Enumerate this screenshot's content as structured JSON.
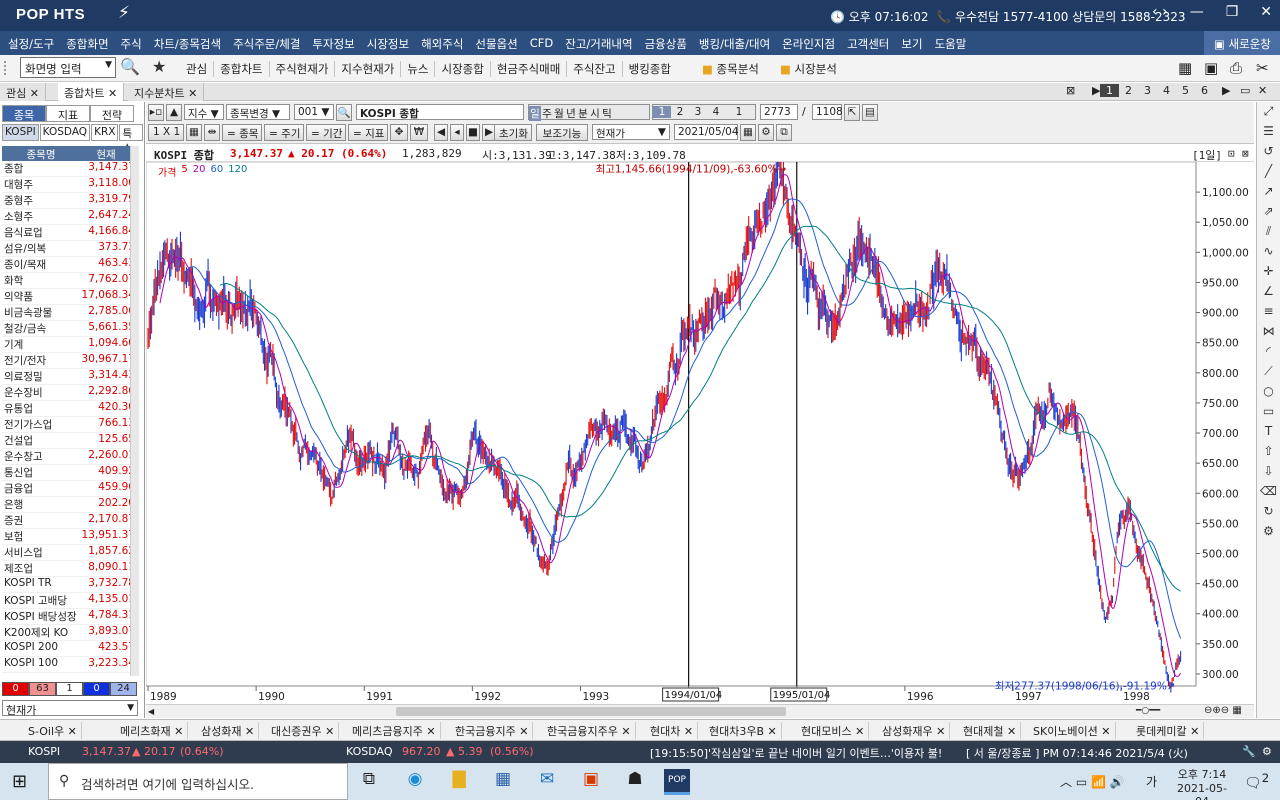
{
  "titlebar": {
    "logo": "POP HTS",
    "clock": "오후 07:16:02",
    "info": "우수전담 1577-4100 상담문의 1588-2323"
  },
  "menu": {
    "items": [
      "설정/도구",
      "종합화면",
      "주식",
      "차트/종목검색",
      "주식주문/체결",
      "투자정보",
      "시장정보",
      "해외주식",
      "선물옵션",
      "CFD",
      "잔고/거래내역",
      "금융상품",
      "뱅킹/대출/대여",
      "온라인지점",
      "고객센터",
      "보기",
      "도움말"
    ],
    "new_window": "새로운창"
  },
  "toolbar": {
    "screen_input": "화면명 입력",
    "links": [
      "관심",
      "종합차트",
      "주식현재가",
      "지수현재가",
      "뉴스",
      "시장종합",
      "현금주식매매",
      "주식잔고",
      "뱅킹종합"
    ],
    "folders": [
      "종목분석",
      "시장분석"
    ]
  },
  "window_tabs": [
    {
      "label": "관심",
      "active": false
    },
    {
      "label": "종합차트",
      "active": true
    },
    {
      "label": "지수분차트",
      "active": false
    }
  ],
  "page_numbers": [
    "1",
    "2",
    "3",
    "4",
    "5",
    "6"
  ],
  "left_panel": {
    "tabs": [
      "종목",
      "지표",
      "전략"
    ],
    "subtabs": [
      "KOSPI",
      "KOSDAQ",
      "KRX",
      "특수"
    ],
    "header": {
      "name": "종목명",
      "price": "현재"
    },
    "rows": [
      [
        "종합",
        "3,147.37"
      ],
      [
        "대형주",
        "3,118.00"
      ],
      [
        "중형주",
        "3,319.79"
      ],
      [
        "소형주",
        "2,647.24"
      ],
      [
        "음식료업",
        "4,166.84"
      ],
      [
        "섬유/의복",
        "373.73"
      ],
      [
        "종이/목재",
        "463.43"
      ],
      [
        "화학",
        "7,762.07"
      ],
      [
        "의약품",
        "17,068.34"
      ],
      [
        "비금속광물",
        "2,785.06"
      ],
      [
        "철강/금속",
        "5,661.35"
      ],
      [
        "기계",
        "1,094.60"
      ],
      [
        "전기/전자",
        "30,967.17"
      ],
      [
        "의료정밀",
        "3,314.43"
      ],
      [
        "운수장비",
        "2,292.86"
      ],
      [
        "유통업",
        "420.30"
      ],
      [
        "전기가스업",
        "766.13"
      ],
      [
        "건설업",
        "125.65"
      ],
      [
        "운수창고",
        "2,260.01"
      ],
      [
        "통신업",
        "409.92"
      ],
      [
        "금융업",
        "459.96"
      ],
      [
        "은행",
        "202.20"
      ],
      [
        "증권",
        "2,170.87"
      ],
      [
        "보험",
        "13,951.37"
      ],
      [
        "서비스업",
        "1,857.62"
      ],
      [
        "제조업",
        "8,090.11"
      ],
      [
        "KOSPI TR",
        "3,732.78"
      ],
      [
        "KOSPI 고배당",
        "4,135.01"
      ],
      [
        "KOSPI 배당성장",
        "4,784.31"
      ],
      [
        "K200제외 KO",
        "3,893.07"
      ],
      [
        "KOSPI 200",
        "423.57"
      ],
      [
        "KOSPI 100",
        "3,223.34"
      ]
    ],
    "counts": [
      "0",
      "63",
      "1",
      "0",
      "24"
    ],
    "select": "현재가"
  },
  "chart_toolbar": {
    "type": "지수",
    "change": "종목변경",
    "code": "001",
    "name": "KOSPI 종합",
    "periods": [
      "일",
      "주",
      "월",
      "년",
      "분",
      "시",
      "틱"
    ],
    "nums": [
      "1",
      "2",
      "3",
      "4",
      "1"
    ],
    "count": "2773",
    "total": "1108",
    "ratio": "1 X 1",
    "btn_stock": "= 종목",
    "btn_period": "= 주기",
    "btn_range": "= 기간",
    "btn_indicator": "= 지표",
    "reset": "초기화",
    "aux": "보조기능",
    "price_type": "현재가",
    "date": "2021/05/04"
  },
  "infobar": {
    "name": "KOSPI 종합",
    "price": "3,147.37",
    "change": "▲ 20.17 (0.64%)",
    "volume": "1,283,829",
    "open": "시:3,131.39",
    "high": "고:3,147.38",
    "low": "저:3,109.78",
    "period": "[1일]"
  },
  "legend": [
    {
      "label": "가격",
      "color": "#d40000"
    },
    {
      "label": "5",
      "color": "#d40000"
    },
    {
      "label": "20",
      "color": "#b000b0"
    },
    {
      "label": "60",
      "color": "#2060d0"
    },
    {
      "label": "120",
      "color": "#008080"
    }
  ],
  "chart_data": {
    "type": "line",
    "title": "",
    "x_years": [
      "1989",
      "1990",
      "1991",
      "1992",
      "1993",
      "1994",
      "1995",
      "1996",
      "1997",
      "1998"
    ],
    "markers": [
      "1994/01/04",
      "1995/01/04"
    ],
    "y_ticks": [
      300,
      350,
      400,
      450,
      500,
      550,
      600,
      650,
      700,
      750,
      800,
      850,
      900,
      950,
      1000,
      1050,
      1100
    ],
    "ylim": [
      280,
      1150
    ],
    "annotation_high": "최고1,145.66(1994/11/09),-63.60%",
    "annotation_low": "최저277.37(1998/06/16),-91.19%",
    "series": [
      {
        "values_by_time": [
          [
            1989.0,
            870
          ],
          [
            1989.1,
            950
          ],
          [
            1989.3,
            1000
          ],
          [
            1989.45,
            900
          ],
          [
            1989.55,
            930
          ],
          [
            1989.7,
            920
          ],
          [
            1989.85,
            890
          ],
          [
            1990.0,
            880
          ],
          [
            1990.15,
            800
          ],
          [
            1990.3,
            740
          ],
          [
            1990.5,
            650
          ],
          [
            1990.7,
            580
          ],
          [
            1990.85,
            700
          ],
          [
            1990.95,
            650
          ],
          [
            1991.1,
            640
          ],
          [
            1991.3,
            690
          ],
          [
            1991.5,
            630
          ],
          [
            1991.6,
            680
          ],
          [
            1991.75,
            590
          ],
          [
            1991.9,
            620
          ],
          [
            1992.0,
            690
          ],
          [
            1992.15,
            640
          ],
          [
            1992.3,
            610
          ],
          [
            1992.5,
            560
          ],
          [
            1992.65,
            480
          ],
          [
            1992.7,
            470
          ],
          [
            1992.8,
            580
          ],
          [
            1992.9,
            650
          ],
          [
            1993.0,
            660
          ],
          [
            1993.2,
            700
          ],
          [
            1993.4,
            730
          ],
          [
            1993.6,
            660
          ],
          [
            1993.75,
            760
          ],
          [
            1993.9,
            840
          ],
          [
            1994.0,
            870
          ],
          [
            1994.15,
            900
          ],
          [
            1994.3,
            920
          ],
          [
            1994.5,
            960
          ],
          [
            1994.7,
            1080
          ],
          [
            1994.86,
            1145.66
          ],
          [
            1994.95,
            1000
          ],
          [
            1995.05,
            1000
          ],
          [
            1995.2,
            900
          ],
          [
            1995.35,
            880
          ],
          [
            1995.5,
            990
          ],
          [
            1995.6,
            1000
          ],
          [
            1995.75,
            930
          ],
          [
            1995.9,
            880
          ],
          [
            1996.0,
            870
          ],
          [
            1996.15,
            900
          ],
          [
            1996.3,
            970
          ],
          [
            1996.4,
            950
          ],
          [
            1996.55,
            860
          ],
          [
            1996.7,
            800
          ],
          [
            1996.85,
            760
          ],
          [
            1996.95,
            680
          ],
          [
            1997.05,
            640
          ],
          [
            1997.2,
            700
          ],
          [
            1997.35,
            770
          ],
          [
            1997.45,
            730
          ],
          [
            1997.55,
            720
          ],
          [
            1997.65,
            640
          ],
          [
            1997.8,
            450
          ],
          [
            1997.85,
            380
          ],
          [
            1997.92,
            420
          ],
          [
            1997.98,
            550
          ],
          [
            1998.08,
            560
          ],
          [
            1998.2,
            470
          ],
          [
            1998.35,
            360
          ],
          [
            1998.46,
            277.37
          ],
          [
            1998.55,
            330
          ]
        ]
      }
    ]
  },
  "stock_tabs": [
    "S-Oil우",
    "메리츠화재",
    "삼성화재",
    "대신증권우",
    "메리츠금융지주",
    "한국금융지주",
    "한국금융지주우",
    "현대차",
    "현대차3우B",
    "현대모비스",
    "삼성화재우",
    "현대제철",
    "SK이노베이션",
    "롯데케미칼"
  ],
  "ticker": {
    "kospi_label": "KOSPI",
    "kospi_val": "3,147.37",
    "kospi_chg": "▲ 20.17",
    "kospi_pct": "(0.64%)",
    "kosdaq_label": "KOSDAQ",
    "kosdaq_val": "967.20",
    "kosdaq_chg": "▲ 5.39",
    "kosdaq_pct": "(0.56%)",
    "news": "[19:15:50]'작심삼일'로 끝난 네이버 일기 이벤트…'이용자 불!",
    "status": "[ 서 울/장종료 ] PM 07:14:46  2021/5/4 (火)"
  },
  "taskbar": {
    "search_placeholder": "검색하려면 여기에 입력하십시오.",
    "time": "오후 7:14",
    "date": "2021-05-04",
    "notify": "2",
    "lang": "가"
  }
}
